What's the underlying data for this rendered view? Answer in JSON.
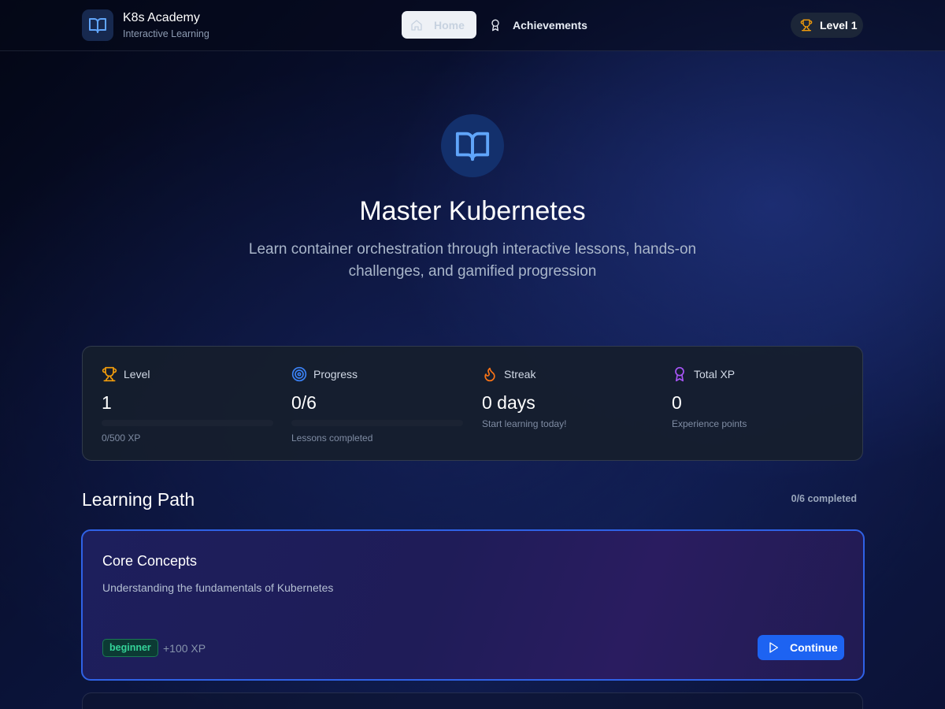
{
  "app": {
    "name": "K8s Academy",
    "subtitle": "Interactive Learning",
    "logo_icon": "book-open-icon"
  },
  "nav": {
    "items": [
      {
        "label": "Home",
        "icon": "home-icon",
        "active": true
      },
      {
        "label": "Achievements",
        "icon": "award-icon",
        "active": false
      }
    ],
    "level_badge": {
      "label": "Level 1",
      "icon": "trophy-icon"
    }
  },
  "hero": {
    "icon": "book-open-icon",
    "title": "Master Kubernetes",
    "description": "Learn container orchestration through interactive lessons, hands-on challenges, and gamified progression"
  },
  "stats": [
    {
      "label": "Level",
      "icon": "trophy-icon",
      "value": "1",
      "note": "0/500 XP",
      "progress": 0,
      "color": "#f59e0b"
    },
    {
      "label": "Progress",
      "icon": "target-icon",
      "value": "0/6",
      "note": "Lessons completed",
      "progress": 0,
      "color": "#3b82f6"
    },
    {
      "label": "Streak",
      "icon": "flame-icon",
      "value": "0 days",
      "note": "Start learning today!",
      "color": "#f97316"
    },
    {
      "label": "Total XP",
      "icon": "award-icon",
      "value": "0",
      "note": "Experience points",
      "color": "#a855f7"
    }
  ],
  "learning_path": {
    "title": "Learning Path",
    "completed": "0/6 completed",
    "lessons": [
      {
        "title": "Core Concepts",
        "description": "Understanding the fundamentals of Kubernetes",
        "difficulty": "beginner",
        "xp": "+100 XP",
        "action": "Continue"
      }
    ]
  },
  "colors": {
    "accent": "#1d63f2",
    "lesson_border": "#2f62e6",
    "beginner": "#34d399"
  }
}
